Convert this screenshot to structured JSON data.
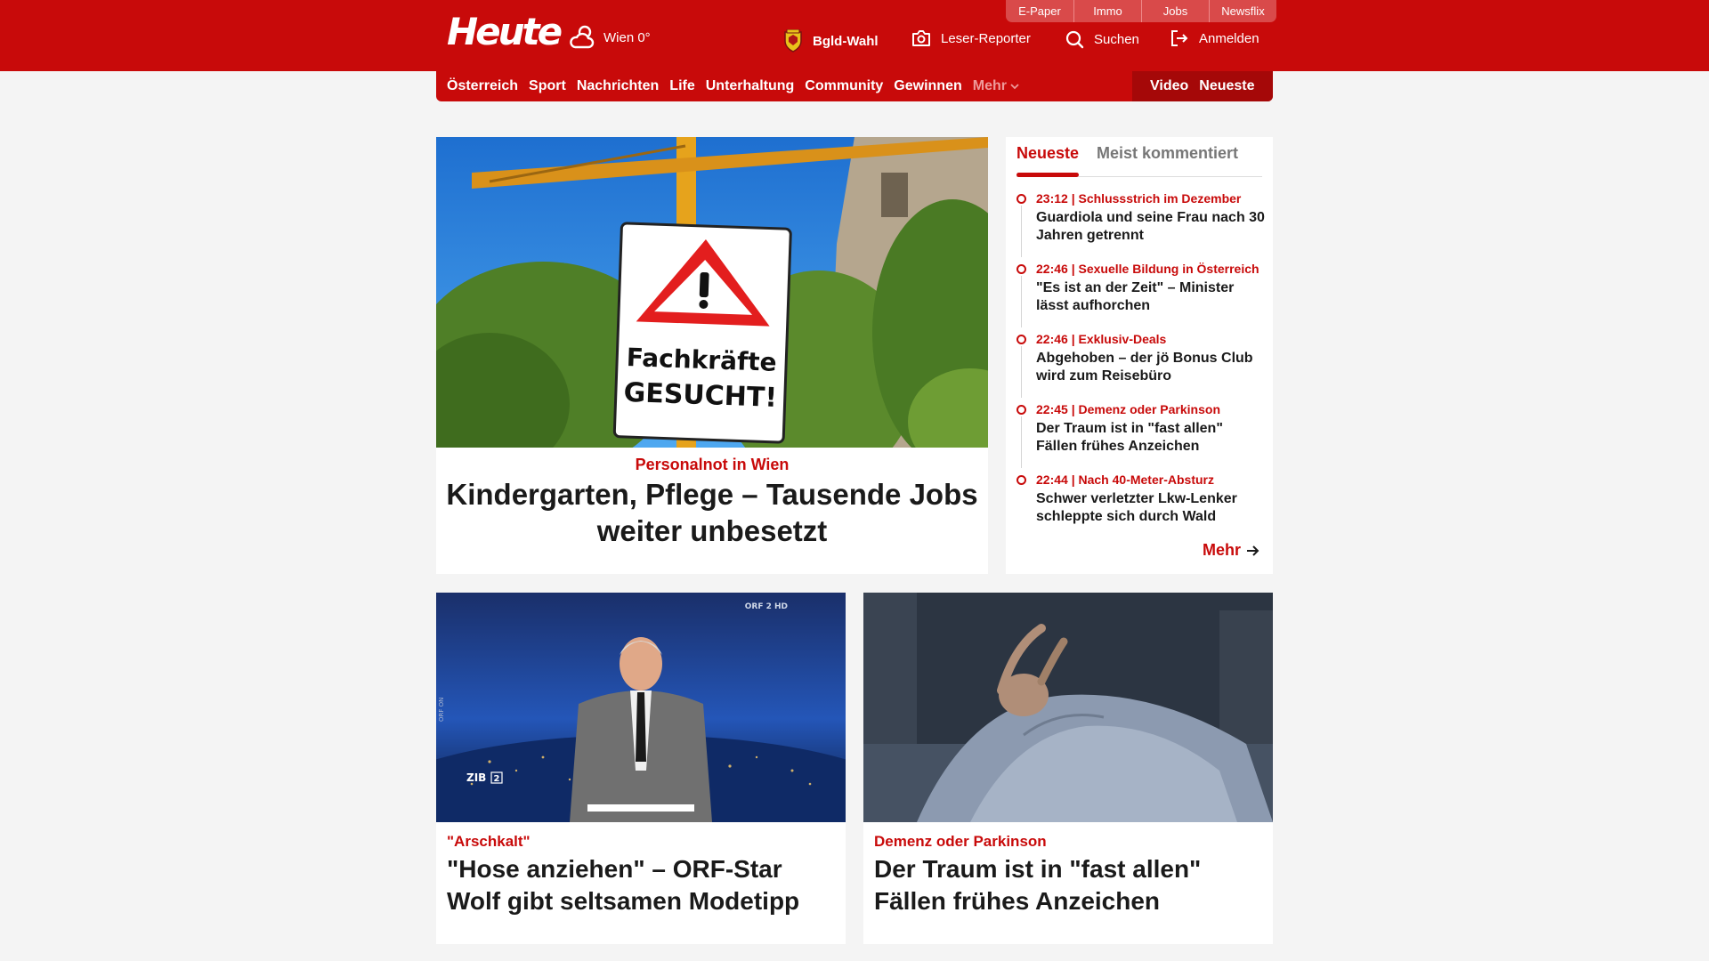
{
  "topbar": [
    "E-Paper",
    "Immo",
    "Jobs",
    "Newsflix"
  ],
  "header": {
    "logo": "Heute",
    "weather": "Wien 0°",
    "election": "Bgld-Wahl",
    "reporter": "Leser-Reporter",
    "search": "Suchen",
    "login": "Anmelden"
  },
  "nav": {
    "items": [
      "Österreich",
      "Sport",
      "Nachrichten",
      "Life",
      "Unterhaltung",
      "Community",
      "Gewinnen"
    ],
    "more": "Mehr",
    "right": [
      "Video",
      "Neueste"
    ]
  },
  "hero": {
    "sign_line1": "Fachkräfte",
    "sign_line2": "GESUCHT!",
    "kicker": "Personalnot in Wien",
    "title": "Kindergarten, Pflege – Tausende Jobs weiter unbesetzt"
  },
  "sidebar": {
    "tabs": [
      "Neueste",
      "Meist kommentiert"
    ],
    "items": [
      {
        "meta": "23:12 | Schlussstrich im Dezember",
        "title": "Guardiola und seine Frau nach 30 Jahren getrennt"
      },
      {
        "meta": "22:46 | Sexuelle Bildung in Österreich",
        "title": "\"Es ist an der Zeit\" – Minister lässt aufhorchen"
      },
      {
        "meta": "22:46 | Exklusiv-Deals",
        "title": "Abgehoben – der jö Bonus Club wird zum Reisebüro"
      },
      {
        "meta": "22:45 | Demenz oder Parkinson",
        "title": "Der Traum ist in \"fast allen\" Fällen frühes Anzeichen"
      },
      {
        "meta": "22:44 | Nach 40-Meter-Absturz",
        "title": "Schwer verletzter Lkw-Lenker schleppte sich durch Wald"
      }
    ],
    "more": "Mehr"
  },
  "cards": [
    {
      "kicker": "\"Arschkalt\"",
      "title": "\"Hose anziehen\" – ORF-Star Wolf gibt seltsamen Modetipp",
      "badge": "ZIB",
      "badge_num": "2",
      "watermark": "ORF 2 HD",
      "side_label": "ORF ON"
    },
    {
      "kicker": "Demenz oder Parkinson",
      "title": "Der Traum ist in \"fast allen\" Fällen frühes Anzeichen"
    }
  ],
  "colors": {
    "brand_red": "#c80a0a",
    "dark_red": "#a50808",
    "background": "#f4f4f4"
  }
}
